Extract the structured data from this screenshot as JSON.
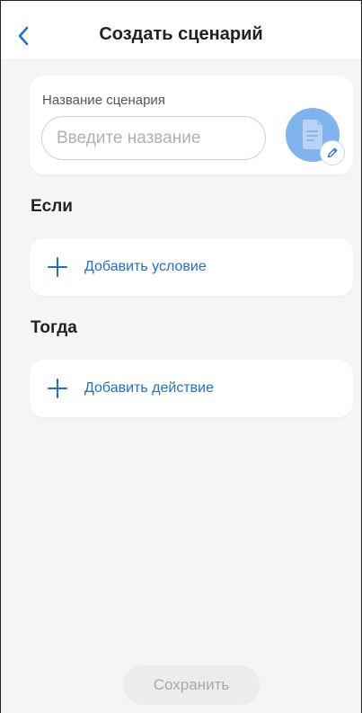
{
  "header": {
    "title": "Создать сценарий",
    "back_icon": "chevron-left-icon"
  },
  "scenario_name": {
    "label": "Название сценария",
    "input_value": "",
    "input_placeholder": "Введите название",
    "avatar_icon": "document-icon",
    "edit_icon": "pencil-icon"
  },
  "if_section": {
    "title": "Если",
    "add_label": "Добавить условие",
    "add_icon": "plus-icon"
  },
  "then_section": {
    "title": "Тогда",
    "add_label": "Добавить действие",
    "add_icon": "plus-icon"
  },
  "footer": {
    "save_label": "Сохранить"
  },
  "colors": {
    "accent": "#1f6fd0",
    "avatar": "#7fb3ee",
    "background": "#f5f5f5",
    "disabled_button": "#ececec",
    "disabled_text": "#a8a8a8"
  }
}
